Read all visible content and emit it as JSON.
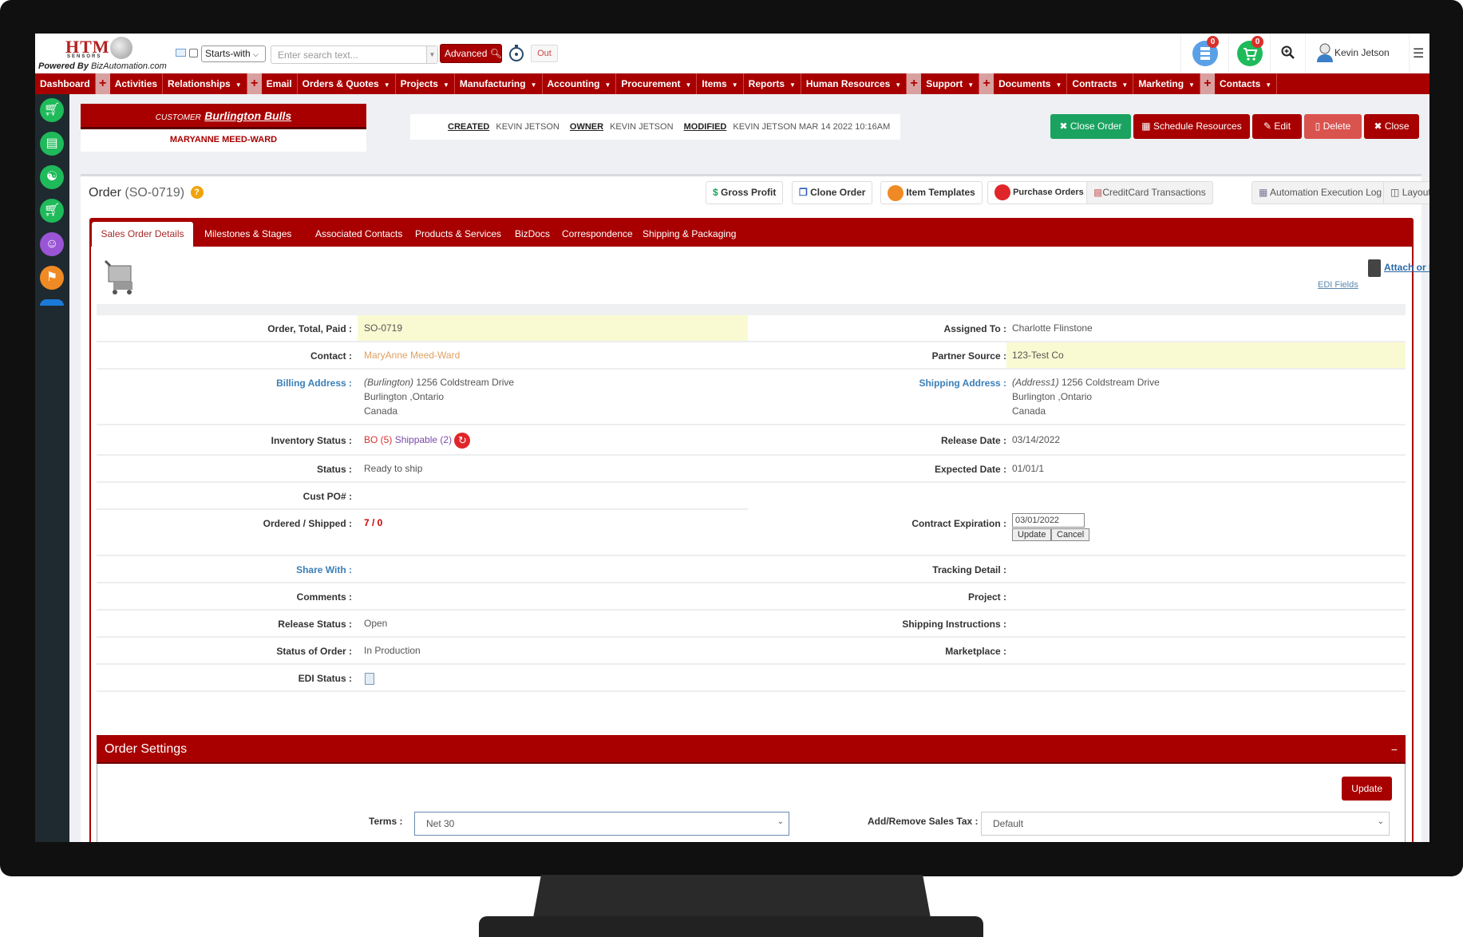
{
  "header": {
    "logo_brand": "HTM",
    "logo_sub": "SENSORS",
    "powered_by_prefix": "Powered By",
    "powered_by_site": "BizAutomation.com",
    "search_mode": "Starts-with",
    "search_placeholder": "Enter search text...",
    "advanced_label": "Advanced",
    "out_label": "Out",
    "notif_count_1": "0",
    "notif_count_2": "0",
    "user_name": "Kevin Jetson"
  },
  "nav": {
    "items": [
      "Dashboard",
      "Activities",
      "Relationships",
      "Email",
      "Orders & Quotes",
      "Projects",
      "Manufacturing",
      "Accounting",
      "Procurement",
      "Items",
      "Reports",
      "Human Resources",
      "Support",
      "Documents",
      "Contracts",
      "Marketing",
      "Contacts"
    ]
  },
  "customer": {
    "label": "CUSTOMER",
    "name": "Burlington Bulls",
    "contact": "MARYANNE MEED-WARD"
  },
  "meta": {
    "created_label": "CREATED",
    "created_by": "KEVIN JETSON",
    "owner_label": "OWNER",
    "owner": "KEVIN JETSON",
    "modified_label": "MODIFIED",
    "modified": "KEVIN JETSON MAR 14 2022 10:16AM"
  },
  "actions": {
    "close_order": "Close Order",
    "schedule": "Schedule Resources",
    "edit": "Edit",
    "delete": "Delete",
    "close": "Close"
  },
  "order": {
    "title": "Order",
    "id": "(SO-0719)",
    "help": "?"
  },
  "toolbar": {
    "gross_profit": "Gross Profit",
    "clone_order": "Clone Order",
    "item_templates": "Item Templates",
    "purchase_orders": "Purchase Orders",
    "creditcard": "CreditCard Transactions",
    "automation_log": "Automation Execution Log",
    "layout": "Layout"
  },
  "tabs": [
    "Sales Order Details",
    "Milestones & Stages",
    "Associated Contacts",
    "Products & Services",
    "BizDocs",
    "Correspondence",
    "Shipping & Packaging"
  ],
  "links": {
    "attach": "Attach or Link",
    "edi_fields": "EDI Fields"
  },
  "fields": {
    "order_total_paid": {
      "label": "Order, Total, Paid :",
      "value": "SO-0719"
    },
    "assigned_to": {
      "label": "Assigned To :",
      "value": "Charlotte Flinstone"
    },
    "contact": {
      "label": "Contact :",
      "value": "MaryAnne Meed-Ward"
    },
    "partner_source": {
      "label": "Partner Source :",
      "value": "123-Test Co"
    },
    "billing_address": {
      "label": "Billing Address :",
      "tag": "(Burlington)",
      "line1": "1256 Coldstream Drive",
      "line2": "Burlington ,Ontario",
      "line3": "Canada"
    },
    "shipping_address": {
      "label": "Shipping Address :",
      "tag": "(Address1)",
      "line1": "1256 Coldstream Drive",
      "line2": "Burlington ,Ontario",
      "line3": "Canada"
    },
    "inventory_status": {
      "label": "Inventory Status :",
      "bo": "BO (5)",
      "shippable": "Shippable (2)"
    },
    "release_date": {
      "label": "Release Date :",
      "value": "03/14/2022"
    },
    "status": {
      "label": "Status :",
      "value": "Ready to ship"
    },
    "expected_date": {
      "label": "Expected Date :",
      "value": "01/01/1"
    },
    "cust_po": {
      "label": "Cust PO# :",
      "value": ""
    },
    "ordered_shipped": {
      "label": "Ordered / Shipped :",
      "value": "7 / 0"
    },
    "contract_expiration": {
      "label": "Contract Expiration :",
      "value": "03/01/2022",
      "update": "Update",
      "cancel": "Cancel"
    },
    "share_with": {
      "label": "Share With :"
    },
    "tracking_detail": {
      "label": "Tracking Detail :"
    },
    "comments": {
      "label": "Comments :"
    },
    "project": {
      "label": "Project :"
    },
    "release_status": {
      "label": "Release Status :",
      "value": "Open"
    },
    "shipping_instructions": {
      "label": "Shipping Instructions :"
    },
    "status_of_order": {
      "label": "Status of Order :",
      "value": "In Production"
    },
    "marketplace": {
      "label": "Marketplace :"
    },
    "edi_status": {
      "label": "EDI Status :"
    }
  },
  "order_settings": {
    "title": "Order Settings",
    "collapse": "−",
    "update": "Update",
    "terms_label": "Terms :",
    "terms_value": "Net 30",
    "tax_label": "Add/Remove Sales Tax :",
    "tax_value": "Default"
  },
  "colors": {
    "brand_red": "#a80000",
    "green": "#1aa260",
    "delete": "#d9534f",
    "link_blue": "#3a7fb8",
    "highlight": "#fafad2"
  }
}
